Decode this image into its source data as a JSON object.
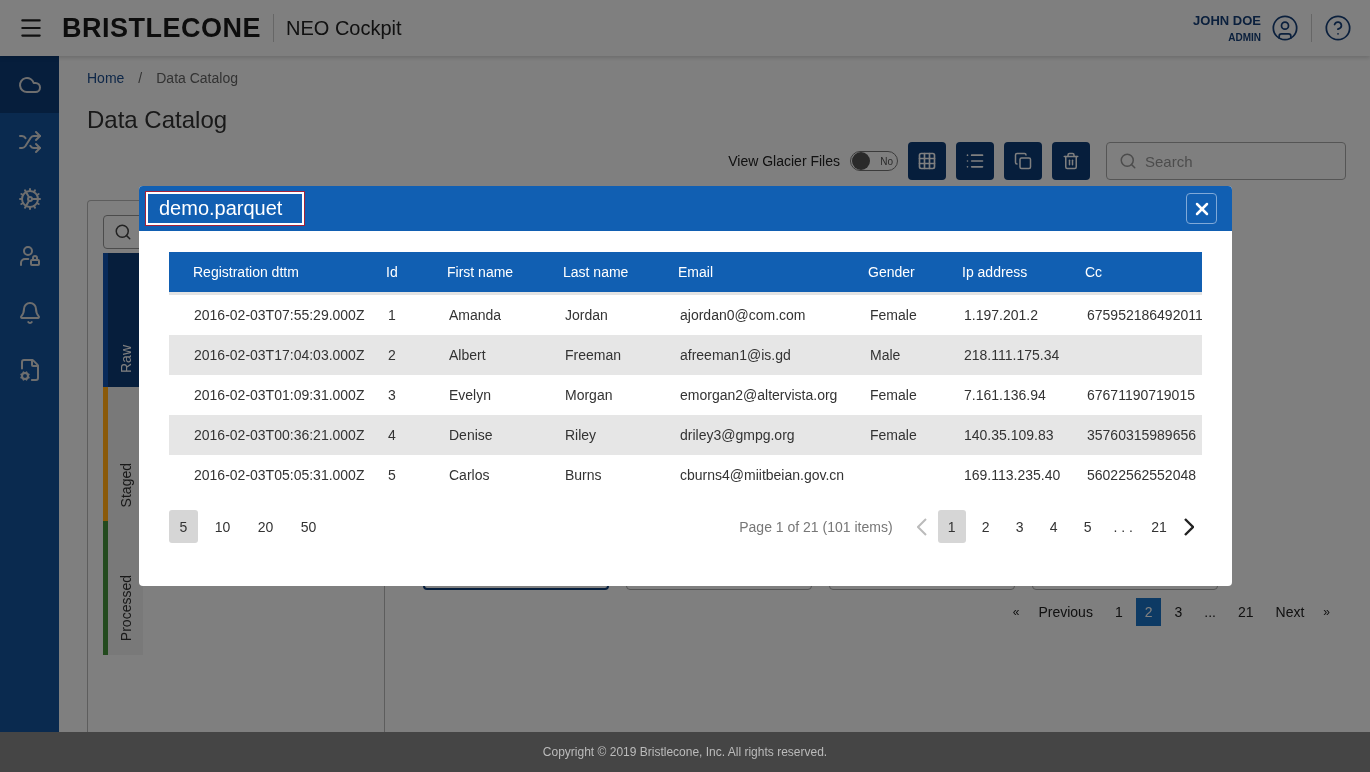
{
  "header": {
    "brand": "BRISTLECONE",
    "app_name": "NEO Cockpit",
    "user_name": "JOHN DOE",
    "user_role": "ADMIN"
  },
  "sidebar": {
    "items": [
      {
        "kind": "cloud",
        "selected": true
      },
      {
        "kind": "shuffle",
        "selected": false
      },
      {
        "kind": "gear",
        "selected": false
      },
      {
        "kind": "user-lock",
        "selected": false
      },
      {
        "kind": "bell",
        "selected": false
      },
      {
        "kind": "file-cog",
        "selected": false
      }
    ]
  },
  "breadcrumb": [
    "Home",
    "Data Catalog"
  ],
  "breadcrumb_separator": "/",
  "page_title": "Data Catalog",
  "toolbar": {
    "toggle_label": "View Glacier Files",
    "toggle_on": false,
    "toggle_text": "No",
    "buttons": [
      {
        "kind": "grid"
      },
      {
        "kind": "list"
      },
      {
        "kind": "copy"
      },
      {
        "kind": "trash"
      }
    ],
    "search_placeholder": "Search"
  },
  "stage_tabs": [
    {
      "label": "Raw",
      "selected": true,
      "color": "#082a5a"
    },
    {
      "label": "Staged",
      "selected": false,
      "color": "#8a5a0a"
    },
    {
      "label": "Processed",
      "selected": false,
      "color": "#234a1e"
    }
  ],
  "cards": [
    {
      "selected": true
    },
    {
      "selected": false
    },
    {
      "selected": false
    },
    {
      "selected": false
    }
  ],
  "pagination": {
    "previous": "Previous",
    "next": "Next",
    "first_mark": "«",
    "last_mark": "»",
    "pages": [
      {
        "label": "1",
        "selected": false
      },
      {
        "label": "2",
        "selected": true
      },
      {
        "label": "3",
        "selected": false
      },
      {
        "label": "...",
        "selected": false
      },
      {
        "label": "21",
        "selected": false
      }
    ]
  },
  "modal": {
    "title": "demo.parquet",
    "table": {
      "columns": [
        "Registration dttm",
        "Id",
        "First name",
        "Last name",
        "Email",
        "Gender",
        "Ip address",
        "Cc"
      ],
      "rows": [
        [
          "2016-02-03T07:55:29.000Z",
          "1",
          "Amanda",
          "Jordan",
          "ajordan0@com.com",
          "Female",
          "1.197.201.2",
          "675952186492011"
        ],
        [
          "2016-02-03T17:04:03.000Z",
          "2",
          "Albert",
          "Freeman",
          "afreeman1@is.gd",
          "Male",
          "218.111.175.34",
          null
        ],
        [
          "2016-02-03T01:09:31.000Z",
          "3",
          "Evelyn",
          "Morgan",
          "emorgan2@altervista.org",
          "Female",
          "7.161.136.94",
          "67671190719015"
        ],
        [
          "2016-02-03T00:36:21.000Z",
          "4",
          "Denise",
          "Riley",
          "driley3@gmpg.org",
          "Female",
          "140.35.109.83",
          "35760315989656"
        ],
        [
          "2016-02-03T05:05:31.000Z",
          "5",
          "Carlos",
          "Burns",
          "cburns4@miitbeian.gov.cn",
          null,
          "169.113.235.40",
          "56022562552048"
        ]
      ]
    },
    "page_sizes": [
      {
        "label": "5",
        "selected": true
      },
      {
        "label": "10",
        "selected": false
      },
      {
        "label": "20",
        "selected": false
      },
      {
        "label": "50",
        "selected": false
      }
    ],
    "page_info": "Page 1 of 21 (101 items)",
    "prev_disabled": true,
    "pages": [
      {
        "label": "1",
        "selected": true
      },
      {
        "label": "2",
        "selected": false
      },
      {
        "label": "3",
        "selected": false
      },
      {
        "label": "4",
        "selected": false
      },
      {
        "label": "5",
        "selected": false
      },
      {
        "label": ". . .",
        "selected": false
      },
      {
        "label": "21",
        "selected": false
      }
    ]
  },
  "footer": "Copyright © 2019 Bristlecone, Inc. All rights reserved."
}
